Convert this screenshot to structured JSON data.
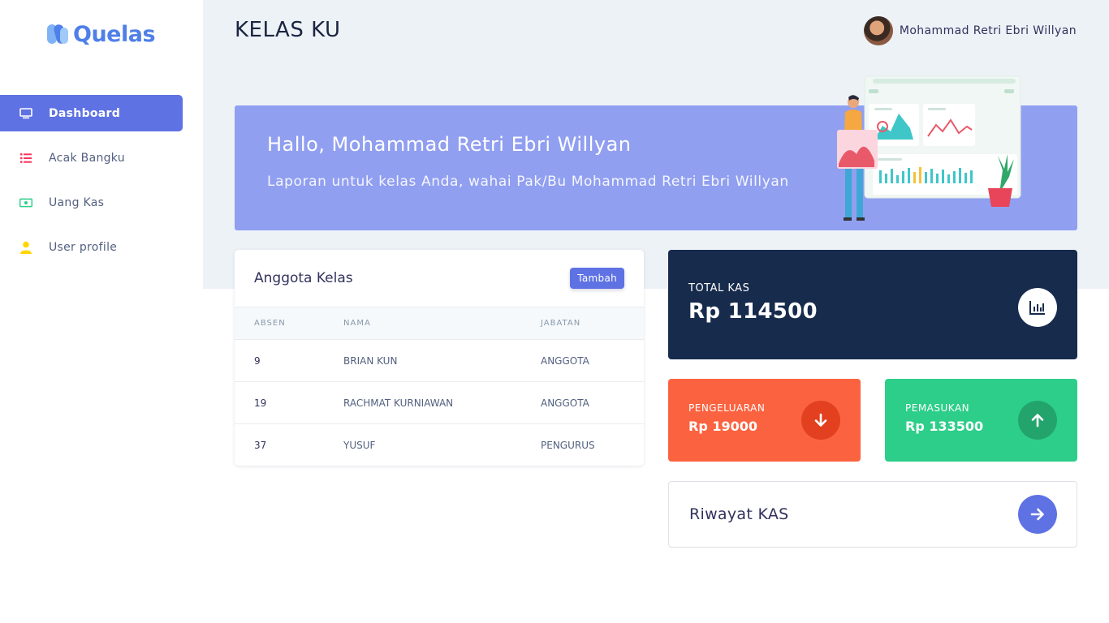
{
  "app": {
    "logo_text": "Quelas"
  },
  "sidebar": {
    "items": [
      {
        "label": "Dashboard",
        "icon": "monitor-icon",
        "active": true
      },
      {
        "label": "Acak Bangku",
        "icon": "list-icon",
        "active": false
      },
      {
        "label": "Uang Kas",
        "icon": "money-icon",
        "active": false
      },
      {
        "label": "User profile",
        "icon": "user-icon",
        "active": false
      }
    ]
  },
  "header": {
    "title": "KELAS KU",
    "user_name": "Mohammad Retri Ebri Willyan"
  },
  "banner": {
    "greeting": "Hallo, Mohammad Retri Ebri Willyan",
    "subtitle": "Laporan untuk kelas Anda, wahai Pak/Bu Mohammad Retri Ebri Willyan"
  },
  "members": {
    "title": "Anggota Kelas",
    "add_label": "Tambah",
    "columns": [
      "ABSEN",
      "NAMA",
      "JABATAN"
    ],
    "rows": [
      [
        "9",
        "BRIAN KUN",
        "ANGGOTA"
      ],
      [
        "19",
        "RACHMAT KURNIAWAN",
        "ANGGOTA"
      ],
      [
        "37",
        "YUSUF",
        "PENGURUS"
      ]
    ]
  },
  "stats": {
    "total": {
      "label": "TOTAL KAS",
      "value": "Rp 114500",
      "icon": "chart-bar-icon"
    },
    "pengeluaran": {
      "label": "PENGELUARAN",
      "value": "Rp 19000",
      "icon": "arrow-down-icon",
      "color": "#fb6340"
    },
    "pemasukan": {
      "label": "PEMASUKAN",
      "value": "Rp 133500",
      "icon": "arrow-up-icon",
      "color": "#2dce89"
    }
  },
  "riwayat": {
    "title": "Riwayat KAS",
    "icon": "arrow-right-icon"
  },
  "colors": {
    "primary": "#5e72e4",
    "banner": "#919ff0",
    "dark": "#172b4d"
  }
}
